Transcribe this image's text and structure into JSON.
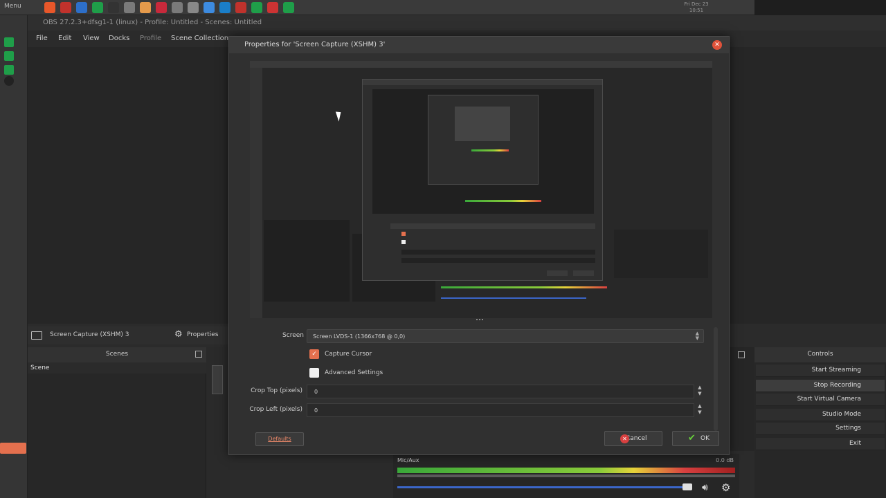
{
  "taskbar": {
    "menu_label": "Menu",
    "clock": "Fri Dec 23 10:51",
    "colors": [
      "#e8572a",
      "#c0322c",
      "#2d6fc9",
      "#1f9e49",
      "#333333",
      "#7a7a7a",
      "#e59a4b",
      "#c7293b",
      "#7a7a7a",
      "#888888",
      "#3d8be0",
      "#1a7ec8",
      "#c0322c",
      "#1f9e49",
      "#cc3333",
      "#1f9e49"
    ]
  },
  "obs": {
    "title": "OBS 27.2.3+dfsg1-1 (linux) - Profile: Untitled - Scenes: Untitled",
    "menus": [
      "File",
      "Edit",
      "View",
      "Docks",
      "Profile",
      "Scene Collection"
    ],
    "source_name": "Screen Capture (XSHM) 3",
    "properties_label": "Properties",
    "scenes_header": "Scenes",
    "scene_item": "Scene",
    "controls_header": "Controls",
    "controls": [
      "Start Streaming",
      "Stop Recording",
      "Start Virtual Camera",
      "Studio Mode",
      "Settings",
      "Exit"
    ],
    "mixer_label": "Mic/Aux",
    "mixer_db": "0.0 dB"
  },
  "dialog": {
    "title": "Properties for 'Screen Capture (XSHM) 3'",
    "screen_label": "Screen",
    "screen_value": "Screen LVDS-1 (1366x768 @ 0,0)",
    "capture_cursor_label": "Capture Cursor",
    "capture_cursor_checked": true,
    "advanced_label": "Advanced Settings",
    "advanced_checked": false,
    "crop_top_label": "Crop Top (pixels)",
    "crop_top_value": "0",
    "crop_left_label": "Crop Left (pixels)",
    "crop_left_value": "0",
    "defaults_label": "Defaults",
    "cancel_label": "Cancel",
    "ok_label": "OK"
  }
}
